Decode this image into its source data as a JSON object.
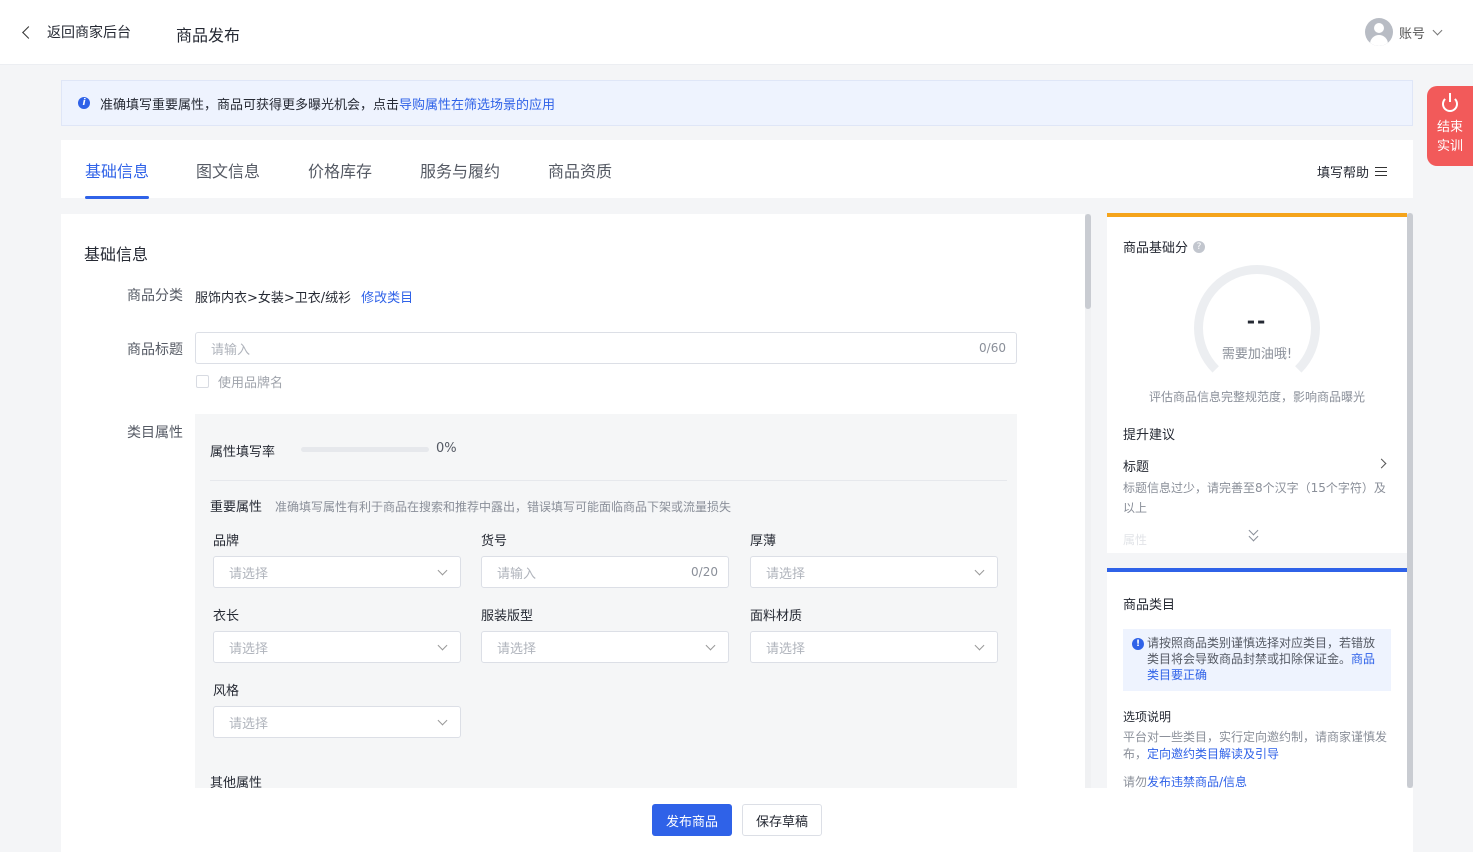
{
  "header": {
    "back_label": "返回商家后台",
    "title": "商品发布",
    "account_label": "账号"
  },
  "end_training": {
    "line1": "结束",
    "line2": "实训"
  },
  "notice": {
    "text": "准确填写重要属性，商品可获得更多曝光机会，点击",
    "link": "导购属性在筛选场景的应用"
  },
  "tabs": [
    {
      "label": "基础信息",
      "active": true
    },
    {
      "label": "图文信息",
      "active": false
    },
    {
      "label": "价格库存",
      "active": false
    },
    {
      "label": "服务与履约",
      "active": false
    },
    {
      "label": "商品资质",
      "active": false
    }
  ],
  "help_label": "填写帮助",
  "form": {
    "section_title": "基础信息",
    "category": {
      "label": "商品分类",
      "value": "服饰内衣>女装>卫衣/绒衫",
      "edit_link": "修改类目"
    },
    "product_title": {
      "label": "商品标题",
      "placeholder": "请输入",
      "counter": "0/60",
      "use_brand": "使用品牌名"
    },
    "attributes": {
      "label": "类目属性",
      "fill_rate_label": "属性填写率",
      "fill_rate_percent": 0,
      "fill_rate_text": "0%",
      "important_title": "重要属性",
      "important_desc": "准确填写属性有利于商品在搜索和推荐中露出，错误填写可能面临商品下架或流量损失",
      "fields": [
        {
          "label": "品牌",
          "placeholder": "请选择",
          "type": "select"
        },
        {
          "label": "货号",
          "placeholder": "请输入",
          "type": "input",
          "counter": "0/20"
        },
        {
          "label": "厚薄",
          "placeholder": "请选择",
          "type": "select"
        },
        {
          "label": "衣长",
          "placeholder": "请选择",
          "type": "select"
        },
        {
          "label": "服装版型",
          "placeholder": "请选择",
          "type": "select"
        },
        {
          "label": "面料材质",
          "placeholder": "请选择",
          "type": "select"
        },
        {
          "label": "风格",
          "placeholder": "请选择",
          "type": "select"
        }
      ],
      "other_title": "其他属性"
    }
  },
  "score_panel": {
    "title": "商品基础分",
    "score": "--",
    "score_sub": "需要加油哦!",
    "desc": "评估商品信息完整规范度，影响商品曝光",
    "suggest_title": "提升建议",
    "suggest_item_title": "标题",
    "suggest_item_desc": "标题信息过少，请完善至8个汉字（15个字符）及以上",
    "suggest_next": "属性"
  },
  "category_panel": {
    "title": "商品类目",
    "warning": "请按照商品类别谨慎选择对应类目，若错放类目将会导致商品封禁或扣除保证金。",
    "warning_link": "商品类目要正确",
    "option_title": "选项说明",
    "option_desc": "平台对一些类目，实行定向邀约制，请商家谨慎发布，",
    "option_link": "定向邀约类目解读及引导",
    "more_prefix": "请勿",
    "more_link": "发布违禁商品/信息"
  },
  "footer": {
    "publish_label": "发布商品",
    "draft_label": "保存草稿"
  },
  "colors": {
    "primary": "#2f62e8",
    "score_accent": "#f5a41b",
    "end_training": "#f25a5a"
  }
}
